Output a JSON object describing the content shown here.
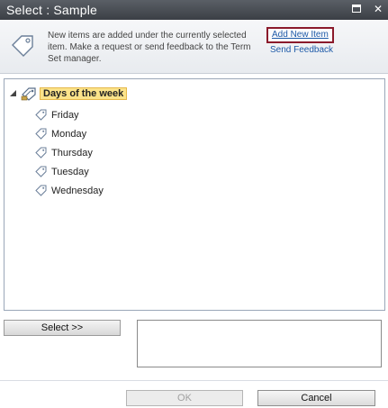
{
  "window": {
    "title": "Select : Sample"
  },
  "info": {
    "message": "New items are added under the currently selected item. Make a request or send feedback to the Term Set manager.",
    "add_new_item": "Add New Item",
    "send_feedback": "Send Feedback"
  },
  "tree": {
    "root_label": "Days of the week",
    "items": [
      {
        "label": "Friday"
      },
      {
        "label": "Monday"
      },
      {
        "label": "Thursday"
      },
      {
        "label": "Tuesday"
      },
      {
        "label": "Wednesday"
      }
    ]
  },
  "selection": {
    "select_button": "Select >>",
    "selected_value": ""
  },
  "footer": {
    "ok": "OK",
    "cancel": "Cancel"
  },
  "colors": {
    "title_bar": "#3b3f45",
    "link": "#1e5aa8",
    "highlight_border": "#8b1a2b",
    "root_highlight": "#fbe38a"
  },
  "icons": {
    "info": "tag-icon",
    "root": "term-set-icon",
    "item": "term-tag-icon"
  }
}
